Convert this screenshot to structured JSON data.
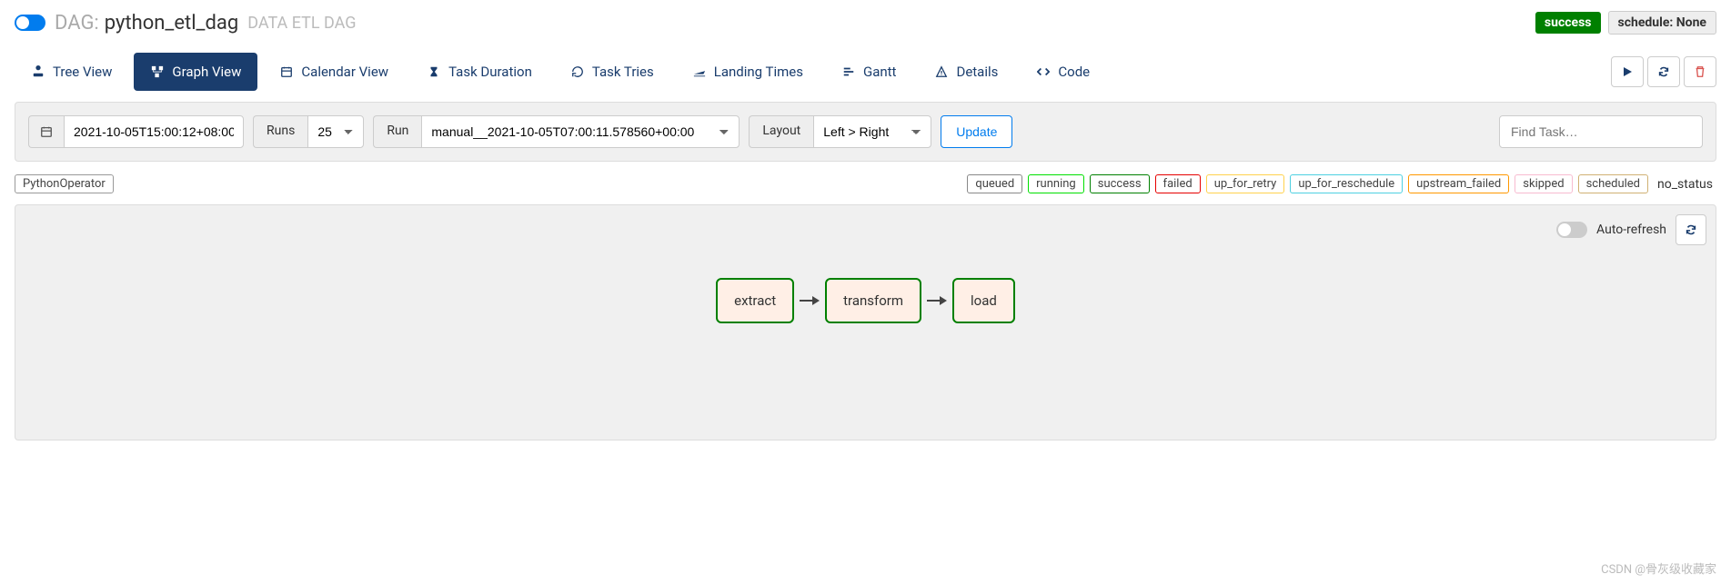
{
  "header": {
    "dag_label": "DAG:",
    "dag_name": "python_etl_dag",
    "dag_desc": "DATA ETL DAG",
    "status_badge": "success",
    "schedule_badge": "schedule: None"
  },
  "tabs": {
    "tree": "Tree View",
    "graph": "Graph View",
    "calendar": "Calendar View",
    "duration": "Task Duration",
    "tries": "Task Tries",
    "landing": "Landing Times",
    "gantt": "Gantt",
    "details": "Details",
    "code": "Code"
  },
  "toolbar": {
    "date_value": "2021-10-05T15:00:12+08:00",
    "runs_label": "Runs",
    "runs_value": "25",
    "run_label": "Run",
    "run_value": "manual__2021-10-05T07:00:11.578560+00:00",
    "layout_label": "Layout",
    "layout_value": "Left > Right",
    "update_label": "Update",
    "find_placeholder": "Find Task…"
  },
  "legend": {
    "operator": "PythonOperator",
    "queued": "queued",
    "running": "running",
    "success": "success",
    "failed": "failed",
    "up_for_retry": "up_for_retry",
    "up_for_reschedule": "up_for_reschedule",
    "upstream_failed": "upstream_failed",
    "skipped": "skipped",
    "scheduled": "scheduled",
    "no_status": "no_status"
  },
  "graph": {
    "auto_refresh_label": "Auto-refresh",
    "nodes": {
      "extract": "extract",
      "transform": "transform",
      "load": "load"
    }
  },
  "watermark": "CSDN @骨灰级收藏家"
}
